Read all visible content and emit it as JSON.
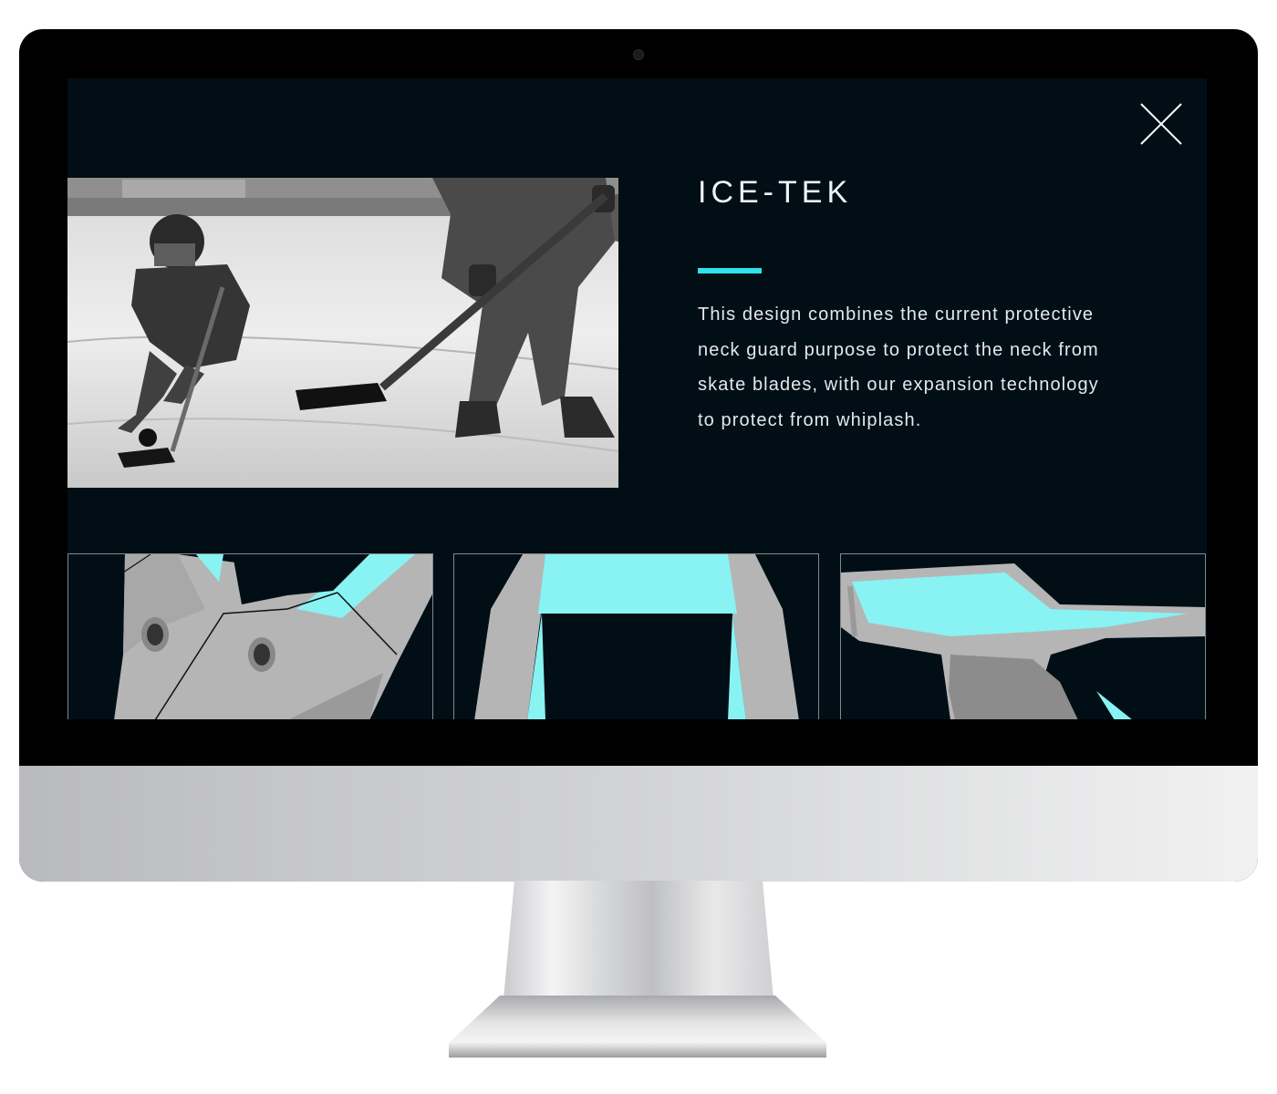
{
  "product": {
    "title": "ICE-TEK",
    "description": "This design combines the current protective neck guard purpose to protect the neck from skate blades, with our expansion technology to protect from whiplash."
  },
  "colors": {
    "screen_background": "#010e15",
    "accent": "#30e1ea",
    "render_cyan": "#89f2f2",
    "render_gray": "#b5b5b5"
  },
  "icons": {
    "close": "close-icon"
  },
  "gallery": {
    "hero_image": "photo-kid-and-adult-playing-hockey-on-frozen-pond",
    "thumbnails": [
      "neck-guard-render-closeup-1",
      "neck-guard-render-closeup-2",
      "neck-guard-render-closeup-3"
    ]
  }
}
